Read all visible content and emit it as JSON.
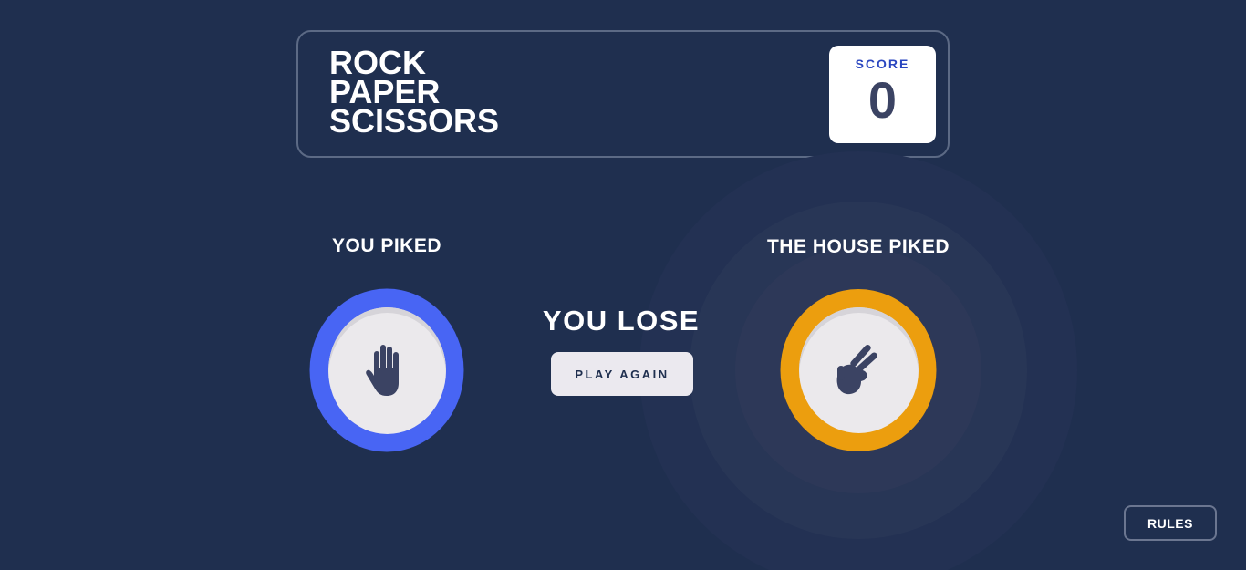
{
  "header": {
    "title_lines": [
      "ROCK",
      "PAPER",
      "SCISSORS"
    ],
    "score_label": "SCORE",
    "score_value": "0"
  },
  "game": {
    "player_label": "YOU PIKED",
    "house_label": "THE HOUSE PIKED",
    "player_pick": {
      "name": "paper",
      "icon": "paper-hand-icon",
      "ring_color": "#4865f4"
    },
    "house_pick": {
      "name": "scissors",
      "icon": "scissors-hand-icon",
      "ring_color": "#ec9e0e"
    },
    "result_text": "YOU LOSE",
    "play_again_label": "PLAY AGAIN",
    "winner": "house"
  },
  "footer": {
    "rules_label": "RULES"
  },
  "colors": {
    "background": "#1f2f4f",
    "header_border": "#5c6a85",
    "score_label": "#2a46c0",
    "score_value": "#3b4363",
    "icon": "#3b4363"
  }
}
